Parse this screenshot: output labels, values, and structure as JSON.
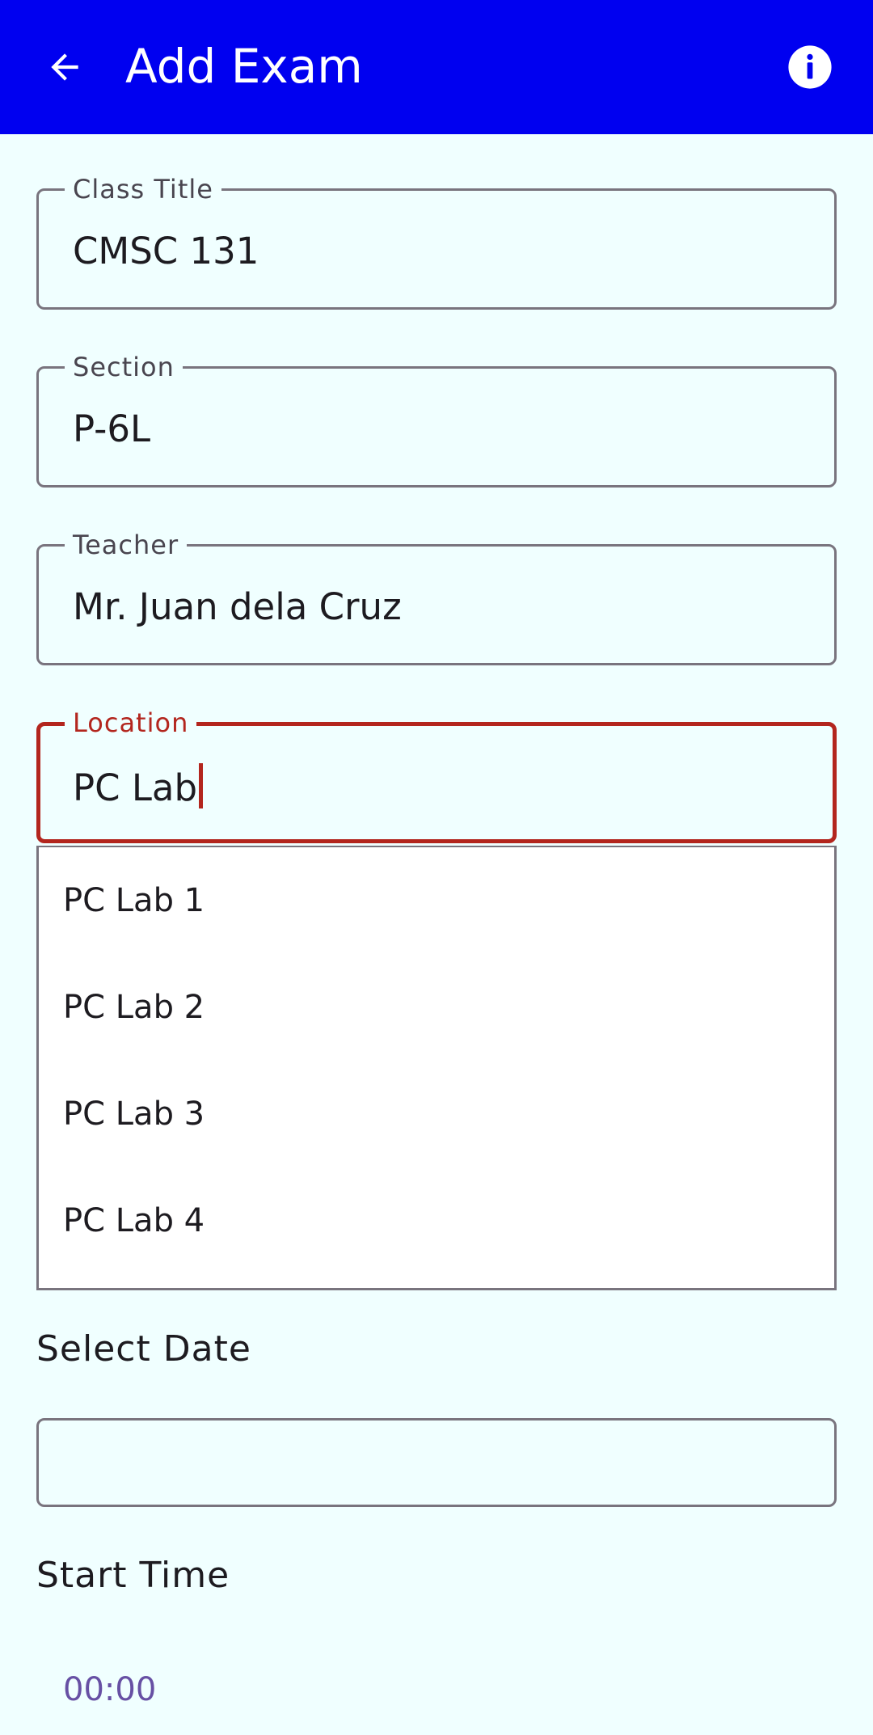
{
  "appbar": {
    "title": "Add Exam",
    "back_icon": "arrow-left-icon",
    "info_icon": "info-circle-icon",
    "background": "#0000F0"
  },
  "form": {
    "class_title": {
      "label": "Class Title",
      "value": "CMSC 131"
    },
    "section": {
      "label": "Section",
      "value": "P-6L"
    },
    "teacher": {
      "label": "Teacher",
      "value": "Mr. Juan dela Cruz"
    },
    "location": {
      "label": "Location",
      "value": "PC Lab",
      "focused": true,
      "accent": "#B3261E"
    }
  },
  "location_suggestions": [
    "PC Lab 1",
    "PC Lab 2",
    "PC Lab 3",
    "PC Lab 4"
  ],
  "date": {
    "label": "Select Date",
    "value": ""
  },
  "start_time": {
    "label": "Start Time",
    "value": "00:00",
    "color": "#6750A4"
  },
  "page_background": "#F0FFFF"
}
